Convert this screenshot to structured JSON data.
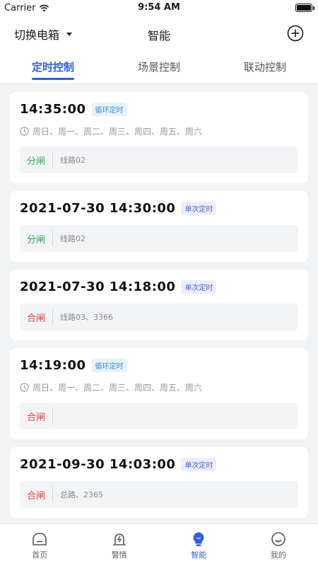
{
  "status_bar": {
    "carrier": "Carrier",
    "time": "9:54 AM"
  },
  "nav": {
    "switch_box_label": "切换电箱",
    "title": "智能"
  },
  "tabs": [
    {
      "label": "定时控制",
      "active": true
    },
    {
      "label": "场景控制",
      "active": false
    },
    {
      "label": "联动控制",
      "active": false
    }
  ],
  "timers": [
    {
      "time": "14:35:00",
      "badge": "循环定时",
      "badge_type": "cycle",
      "weekdays": "周日、周一、周二、周三、周四、周五、周六",
      "action": "分闸",
      "action_type": "open",
      "lines": "线路02"
    },
    {
      "time": "2021-07-30 14:30:00",
      "badge": "单次定时",
      "badge_type": "once",
      "weekdays": "",
      "action": "分闸",
      "action_type": "open",
      "lines": "线路02"
    },
    {
      "time": "2021-07-30 14:18:00",
      "badge": "单次定时",
      "badge_type": "once",
      "weekdays": "",
      "action": "合闸",
      "action_type": "close",
      "lines": "线路03、3366"
    },
    {
      "time": "14:19:00",
      "badge": "循环定时",
      "badge_type": "cycle",
      "weekdays": "周日、周一、周二、周三、周四、周五、周六",
      "action": "合闸",
      "action_type": "close",
      "lines": ""
    },
    {
      "time": "2021-09-30 14:03:00",
      "badge": "单次定时",
      "badge_type": "once",
      "weekdays": "",
      "action": "合闸",
      "action_type": "close",
      "lines": "总路、2365"
    }
  ],
  "tabbar": [
    {
      "label": "首页",
      "icon": "home-icon",
      "active": false
    },
    {
      "label": "警情",
      "icon": "alarm-icon",
      "active": false
    },
    {
      "label": "智能",
      "icon": "smart-bulb-icon",
      "active": true
    },
    {
      "label": "我的",
      "icon": "profile-icon",
      "active": false
    }
  ],
  "colors": {
    "accent": "#2f5fe8",
    "open": "#2ea85a",
    "close": "#e0403f"
  }
}
